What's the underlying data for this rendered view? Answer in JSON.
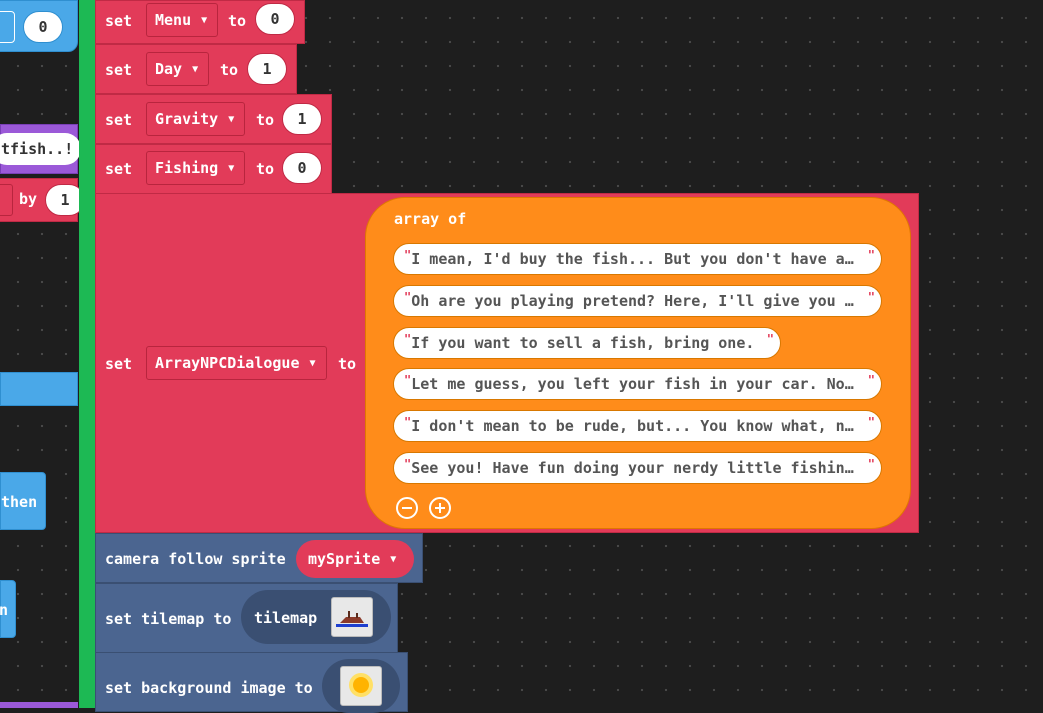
{
  "left_fragments": {
    "top_num": "0",
    "fish_text": "tfish..!",
    "by_label": "by",
    "by_value": "1",
    "then_label": "then",
    "n_label": "n"
  },
  "blocks": {
    "set_label": "set",
    "to_label": "to",
    "menu": {
      "var": "Menu",
      "value": "0"
    },
    "day": {
      "var": "Day",
      "value": "1"
    },
    "gravity": {
      "var": "Gravity",
      "value": "1"
    },
    "fishing": {
      "var": "Fishing",
      "value": "0"
    },
    "npc": {
      "var": "ArrayNPCDialogue",
      "array_label": "array of",
      "items": [
        "I mean, I'd buy the fish... But you don't have a…",
        "Oh are you playing pretend? Here, I'll give you …",
        "If you want to sell a fish, bring one.",
        "Let me guess, you left your fish in your car. No…",
        "I don't mean to be rude, but... You know what, n…",
        "See you! Have fun doing your nerdy little fishin…"
      ]
    },
    "camera": {
      "label": "camera follow sprite",
      "sprite": "mySprite"
    },
    "tilemap": {
      "label": "set tilemap to",
      "value": "tilemap"
    },
    "background": {
      "label": "set background image to"
    }
  },
  "colors": {
    "workspace": "#1e1e1e",
    "variables": "#e23b59",
    "array": "#ff8c1a",
    "scene": "#4b6590",
    "event": "#1db954",
    "logic": "#4aa8e8"
  },
  "icons": {
    "dropdown": "caret-down-icon",
    "remove": "minus-circle-icon",
    "add": "plus-circle-icon"
  }
}
